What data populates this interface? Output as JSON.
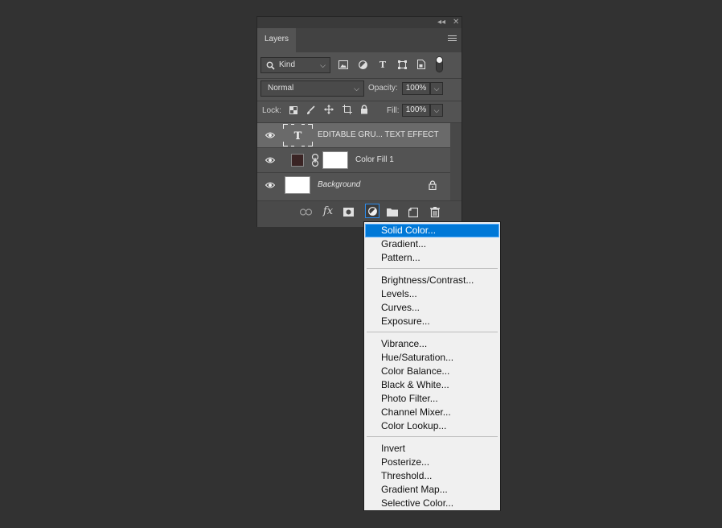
{
  "colors": {
    "accent": "#0078d7",
    "panel_bg": "#535353",
    "app_bg": "#323232"
  },
  "panel": {
    "title_tab": "Layers",
    "collapse_icon": "double-chevron-left-icon",
    "close_icon": "close-icon",
    "menu_icon": "hamburger-menu-icon"
  },
  "filter": {
    "kind_label": "Kind",
    "icons": [
      "image-filter-icon",
      "adjustment-filter-icon",
      "type-filter-icon",
      "shape-filter-icon",
      "smart-object-filter-icon",
      "filter-toggle-icon"
    ]
  },
  "blend": {
    "mode": "Normal",
    "opacity_label": "Opacity:",
    "opacity_value": "100%"
  },
  "lock": {
    "label": "Lock:",
    "icons": [
      "lock-transparent-pixels-icon",
      "lock-image-pixels-icon",
      "lock-position-icon",
      "lock-artboard-icon",
      "lock-all-icon"
    ],
    "fill_label": "Fill:",
    "fill_value": "100%"
  },
  "layers": [
    {
      "name": "EDITABLE GRU... TEXT EFFECT",
      "type": "text",
      "visible": true,
      "selected": true
    },
    {
      "name": "Color Fill 1",
      "type": "fill",
      "visible": true,
      "selected": false,
      "swatch_color": "#3a2424"
    },
    {
      "name": "Background",
      "type": "background",
      "visible": true,
      "selected": false,
      "locked": true
    }
  ],
  "bottom_bar": {
    "icons": [
      "link-layers-icon",
      "fx-layer-style-icon",
      "add-mask-icon",
      "new-adjustment-layer-icon",
      "new-group-icon",
      "new-layer-icon",
      "delete-layer-icon"
    ],
    "fx_text": "fx"
  },
  "adjustment_menu": {
    "groups": [
      [
        "Solid Color...",
        "Gradient...",
        "Pattern..."
      ],
      [
        "Brightness/Contrast...",
        "Levels...",
        "Curves...",
        "Exposure..."
      ],
      [
        "Vibrance...",
        "Hue/Saturation...",
        "Color Balance...",
        "Black & White...",
        "Photo Filter...",
        "Channel Mixer...",
        "Color Lookup..."
      ],
      [
        "Invert",
        "Posterize...",
        "Threshold...",
        "Gradient Map...",
        "Selective Color..."
      ]
    ],
    "highlighted": "Solid Color..."
  }
}
